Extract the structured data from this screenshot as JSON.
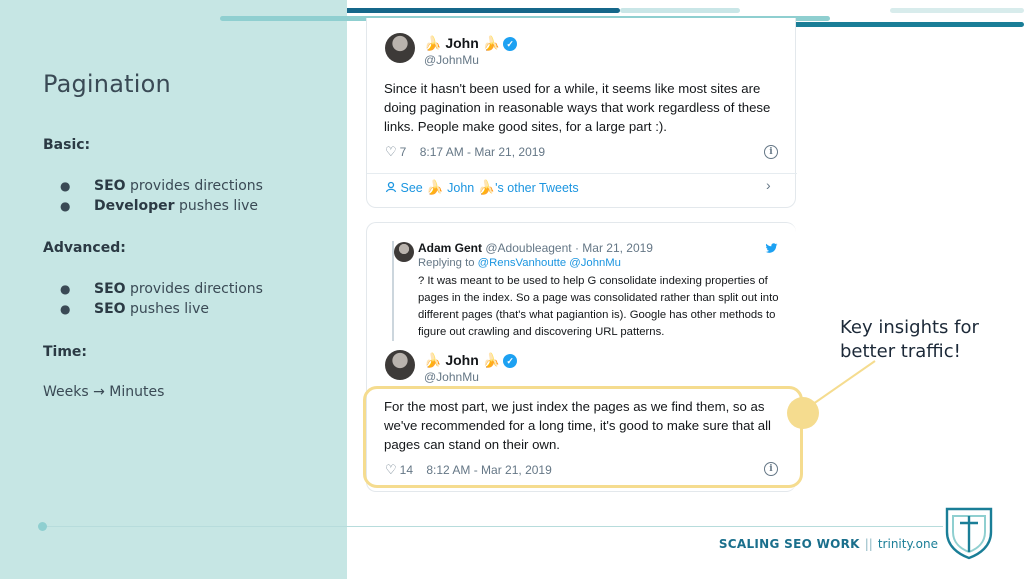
{
  "slide": {
    "title": "Pagination",
    "basic": {
      "heading": "Basic:",
      "items": [
        {
          "bold": "SEO",
          "rest": " provides directions"
        },
        {
          "bold": "Developer",
          "rest": " pushes live"
        }
      ]
    },
    "advanced": {
      "heading": "Advanced:",
      "items": [
        {
          "bold": "SEO",
          "rest": " provides directions"
        },
        {
          "bold": "SEO",
          "rest": " pushes live"
        }
      ]
    },
    "time": {
      "heading": "Time:",
      "value": "Weeks → Minutes"
    }
  },
  "tweet1": {
    "name": "John",
    "handle": "@JohnMu",
    "text": "Since it hasn't been used for a while, it seems like most sites are doing pagination in reasonable ways that work regardless of these links. People make good sites, for a large part :).",
    "likes": "7",
    "time": "8:17 AM - Mar 21, 2019",
    "see_more_prefix": "See",
    "see_more_name": "John",
    "see_more_suffix": "'s other Tweets"
  },
  "reply": {
    "name": "Adam Gent",
    "handle_date": "@Adoubleagent · Mar 21, 2019",
    "replying_prefix": "Replying to ",
    "replying_to": "@RensVanhoutte @JohnMu",
    "text": "? It was meant to be used to help G consolidate indexing properties of pages in the index. So a page was consolidated rather than split out into different pages (that's what pagiantion is). Google has other methods to figure out crawling and discovering URL patterns."
  },
  "tweet2": {
    "name": "John",
    "handle": "@JohnMu",
    "text": "For the most part, we just index the pages as we find them, so as we've recommended for a long time, it's good to make sure that all pages can stand on their own.",
    "likes": "14",
    "time": "8:12 AM - Mar 21, 2019"
  },
  "callout": "Key insights for\nbetter traffic!",
  "footer": {
    "brand": "SCALING SEO WORK",
    "separator": "||",
    "site": "trinity.one"
  },
  "icons": {
    "like": "heart-icon",
    "info": "info-icon",
    "verified": "verified-badge-icon",
    "twitter": "twitter-bird-icon",
    "chevron": "chevron-right-icon",
    "person": "person-icon"
  },
  "colors": {
    "panel": "#c6e6e4",
    "accent": "#1a7e97",
    "highlight": "#f5dc8f",
    "link": "#1b95e0"
  }
}
